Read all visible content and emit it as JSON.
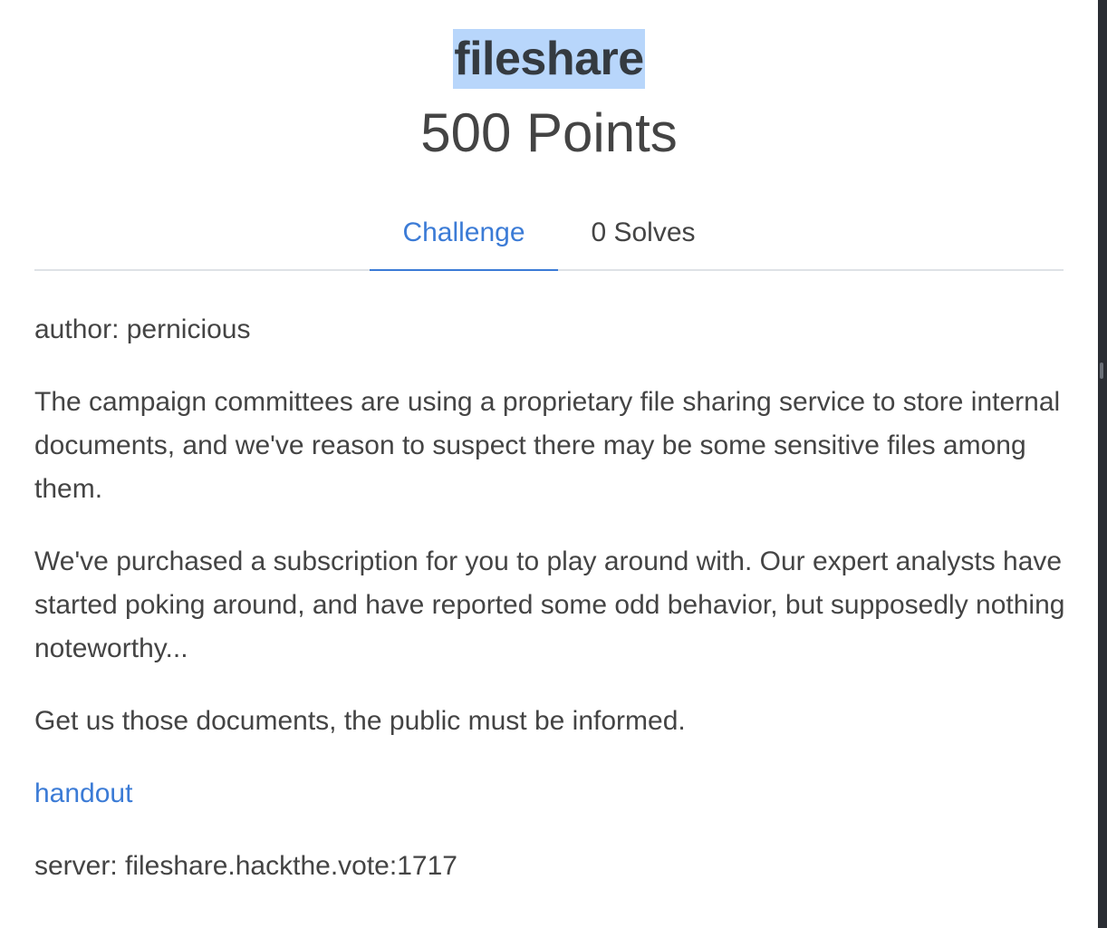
{
  "challenge": {
    "title": "fileshare",
    "points": "500 Points"
  },
  "tabs": {
    "challenge": "Challenge",
    "solves": "0 Solves"
  },
  "description": {
    "author": "author: pernicious",
    "paragraph1": "The campaign committees are using a proprietary file sharing service to store internal documents, and we've reason to suspect there may be some sensitive files among them.",
    "paragraph2": "We've purchased a subscription for you to play around with. Our expert analysts have started poking around, and have reported some odd behavior, but supposedly nothing noteworthy...",
    "paragraph3": "Get us those documents, the public must be informed.",
    "handout_link": "handout",
    "server": "server: fileshare.hackthe.vote:1717"
  },
  "colors": {
    "accent": "#3b7bd6",
    "text": "#444444",
    "selection": "#b8d6fb"
  }
}
